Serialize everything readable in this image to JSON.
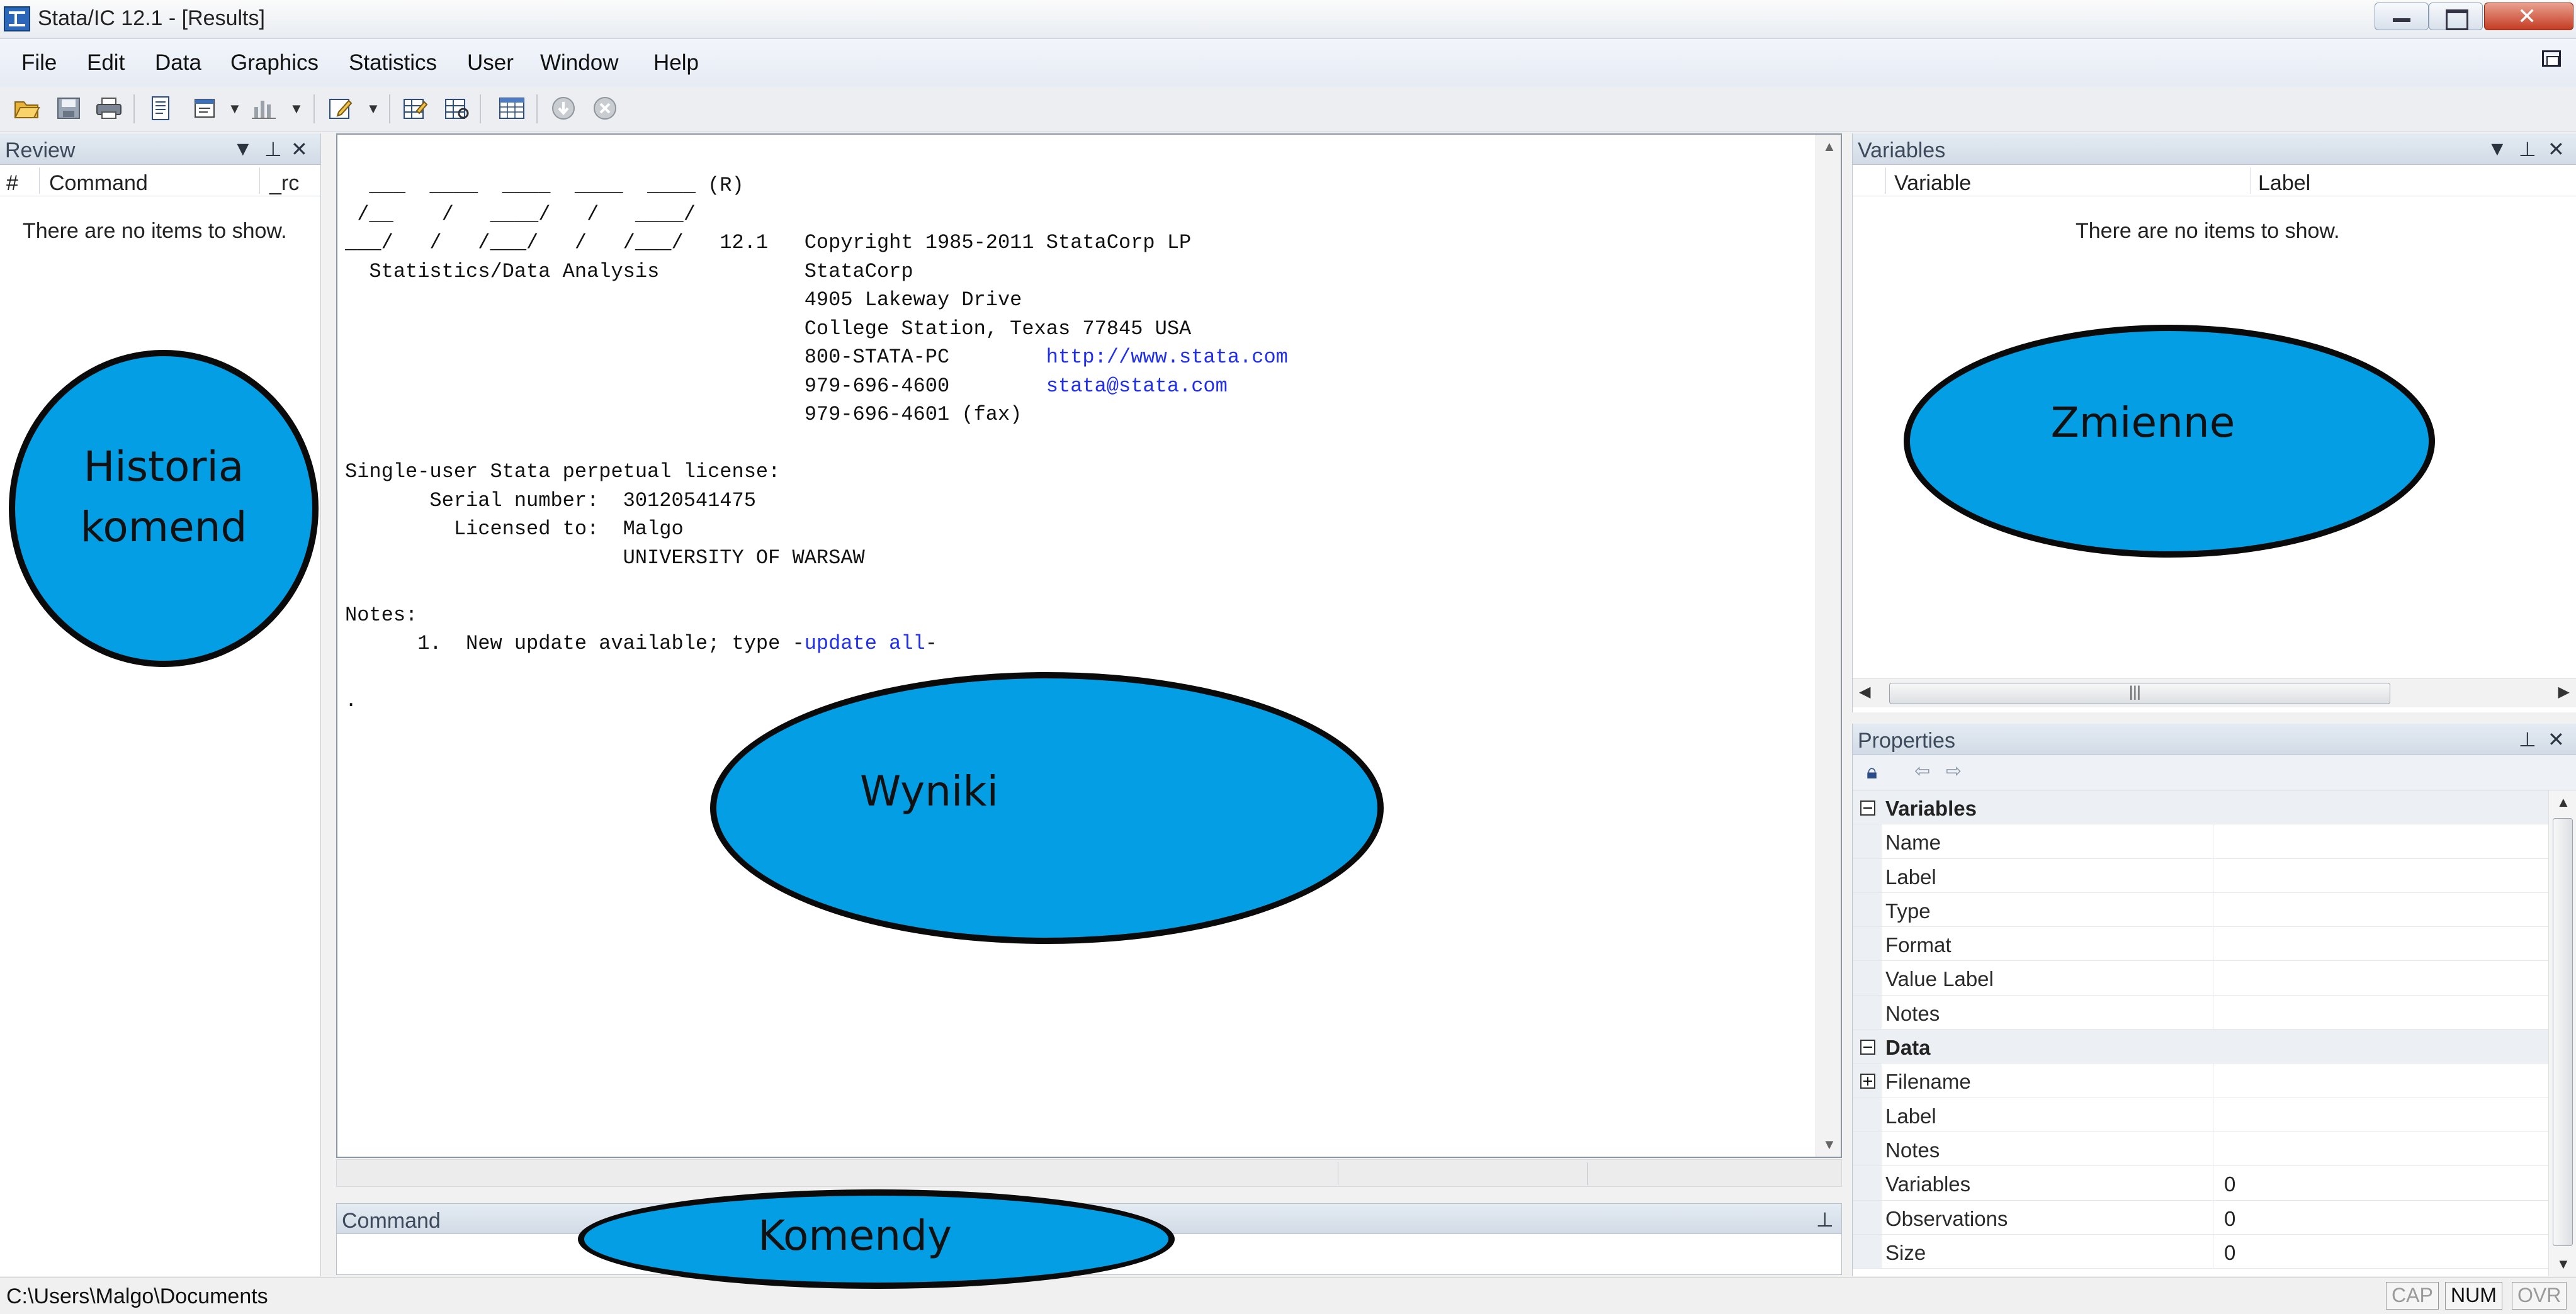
{
  "window": {
    "title": "Stata/IC 12.1 - [Results]"
  },
  "menu": [
    "File",
    "Edit",
    "Data",
    "Graphics",
    "Statistics",
    "User",
    "Window",
    "Help"
  ],
  "toolbar_icons": [
    "open-icon",
    "save-icon",
    "print-icon",
    "log-icon",
    "viewer-icon",
    "graph-icon",
    "do-file-editor-icon",
    "data-editor-icon",
    "data-browser-icon",
    "variables-manager-icon",
    "more-icon",
    "break-icon"
  ],
  "review": {
    "title": "Review",
    "columns": [
      "#",
      "Command",
      "_rc"
    ],
    "empty": "There are no items to show."
  },
  "results": {
    "lines": [
      "  ___  ____  ____  ____  ____ (R)",
      " /__    /   ____/   /   ____/",
      "___/   /   /___/   /   /___/   12.1   Copyright 1985-2011 StataCorp LP",
      "  Statistics/Data Analysis            StataCorp",
      "                                      4905 Lakeway Drive",
      "                                      College Station, Texas 77845 USA",
      "                                      800-STATA-PC        |http://www.stata.com",
      "                                      979-696-4600        |stata@stata.com",
      "                                      979-696-4601 (fax)",
      "",
      "Single-user Stata perpetual license:",
      "       Serial number:  30120541475",
      "         Licensed to:  Malgo",
      "                       UNIVERSITY OF WARSAW",
      "",
      "Notes:",
      "      1.  New update available; type -|update all|-",
      "",
      "."
    ]
  },
  "command": {
    "title": "Command"
  },
  "variables": {
    "title": "Variables",
    "columns": [
      "Variable",
      "Label"
    ],
    "empty": "There are no items to show."
  },
  "properties": {
    "title": "Properties",
    "rows": [
      {
        "key": "Variables",
        "value": "",
        "group": true,
        "expander": "minus"
      },
      {
        "key": "Name",
        "value": ""
      },
      {
        "key": "Label",
        "value": ""
      },
      {
        "key": "Type",
        "value": ""
      },
      {
        "key": "Format",
        "value": ""
      },
      {
        "key": "Value Label",
        "value": ""
      },
      {
        "key": "Notes",
        "value": ""
      },
      {
        "key": "Data",
        "value": "",
        "group": true,
        "expander": "minus"
      },
      {
        "key": "Filename",
        "value": "",
        "expander": "plus"
      },
      {
        "key": "Label",
        "value": ""
      },
      {
        "key": "Notes",
        "value": ""
      },
      {
        "key": "Variables",
        "value": "0"
      },
      {
        "key": "Observations",
        "value": "0"
      },
      {
        "key": "Size",
        "value": "0"
      }
    ]
  },
  "status": {
    "path": "C:\\Users\\Malgo\\Documents",
    "indicators": [
      {
        "label": "CAP",
        "active": false
      },
      {
        "label": "NUM",
        "active": true
      },
      {
        "label": "OVR",
        "active": false
      }
    ]
  },
  "annotations": {
    "history": [
      "Historia",
      "komend"
    ],
    "variables": "Zmienne",
    "results": "Wyniki",
    "commands": "Komendy",
    "fill_color": "#039ee3"
  }
}
